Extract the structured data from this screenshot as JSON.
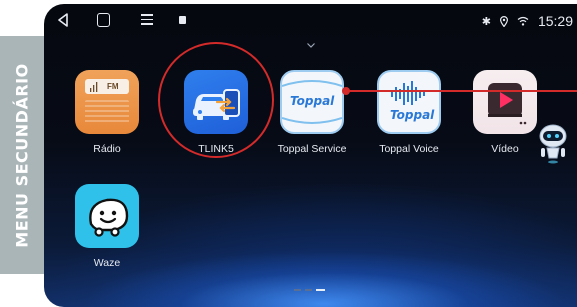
{
  "side_menu": {
    "label": "MENU SECUNDÁRIO"
  },
  "status_bar": {
    "time": "15:29"
  },
  "apps": [
    {
      "label": "Rádio",
      "icon_text": "FM"
    },
    {
      "label": "TLINK5"
    },
    {
      "label": "Toppal Service",
      "icon_text": "Toppal"
    },
    {
      "label": "Toppal Voice",
      "icon_text": "Toppal"
    },
    {
      "label": "Vídeo"
    },
    {
      "label": "Waze"
    }
  ],
  "pager": {
    "pages": 3,
    "current": 3
  },
  "colors": {
    "accent_annotation": "#d32a2a",
    "side_tab": "#aab5b8",
    "screen_background": "#070b16",
    "tlink_tile": "#2f7fee",
    "radio_tile": "#e8883a",
    "waze_tile": "#2fc1ea"
  }
}
